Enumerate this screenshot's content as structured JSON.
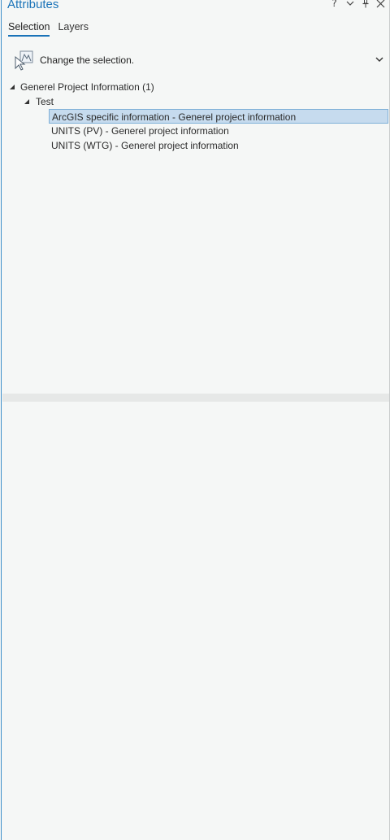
{
  "window": {
    "title": "Attributes",
    "help_label": "?"
  },
  "tabs": [
    {
      "label": "Selection",
      "active": true
    },
    {
      "label": "Layers",
      "active": false
    }
  ],
  "selection": {
    "label": "Change the selection.",
    "icon": "change-selection-icon"
  },
  "tree": {
    "root": {
      "label": "Generel Project Information (1)",
      "expanded": true
    },
    "child": {
      "label": "Test",
      "expanded": true
    },
    "leaves": [
      {
        "label": "ArcGIS specific information - Generel project information",
        "selected": true
      },
      {
        "label": "UNITS (PV) - Generel project information",
        "selected": false
      },
      {
        "label": "UNITS (WTG) - Generel project information",
        "selected": false
      }
    ]
  },
  "colors": {
    "accent": "#1a73b8",
    "selection_bg": "#c6dbee",
    "panel_bg": "#f5f7f6"
  }
}
